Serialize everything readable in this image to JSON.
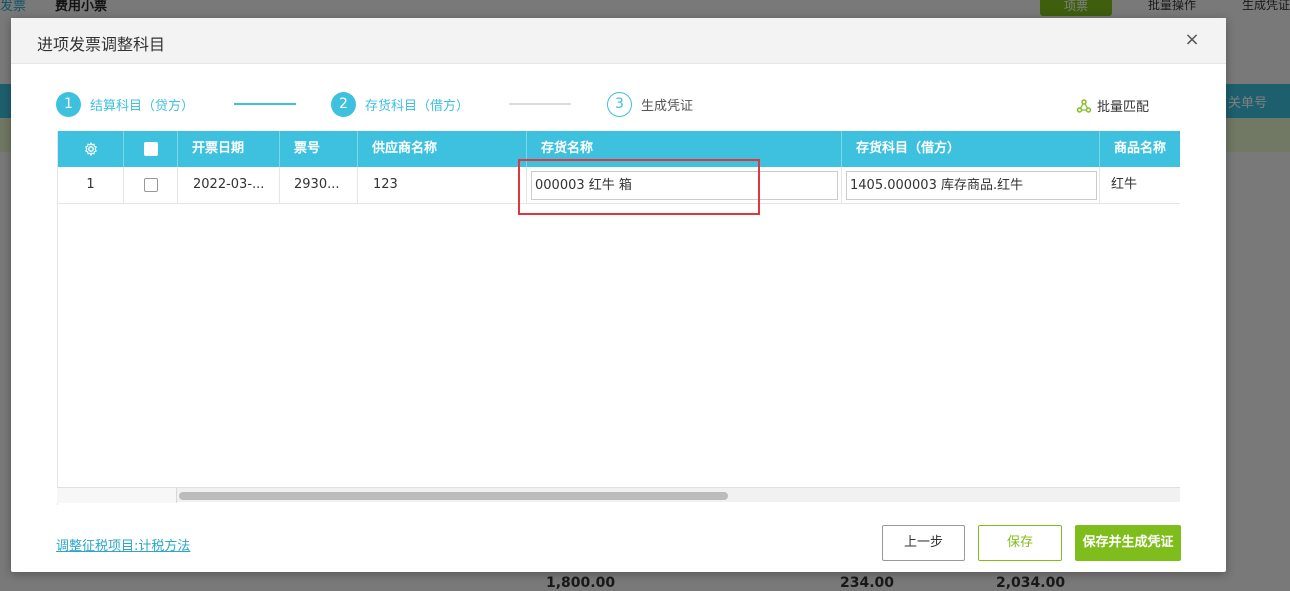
{
  "background": {
    "tab_invoice": "发票",
    "tab_expense": "费用小票",
    "top_button": "项票",
    "top_right_1": "批量操作",
    "top_right_2": "生成凭证",
    "right_header": "关单号",
    "totals": [
      "1,800.00",
      "234.00",
      "2,034.00"
    ]
  },
  "dialog": {
    "title": "进项发票调整科目",
    "close_symbol": "×"
  },
  "steps": [
    {
      "number": "1",
      "label": "结算科目（贷方）",
      "state": "active"
    },
    {
      "number": "2",
      "label": "存货科目（借方）",
      "state": "active"
    },
    {
      "number": "3",
      "label": "生成凭证",
      "state": "pending"
    }
  ],
  "batch_match": {
    "label": "批量匹配",
    "icon": "network-icon"
  },
  "table": {
    "headers": {
      "settings_icon": "gear-icon",
      "invoice_date": "开票日期",
      "invoice_no": "票号",
      "supplier": "供应商名称",
      "inventory_name": "存货名称",
      "inventory_account": "存货科目（借方）",
      "product_name": "商品名称"
    },
    "rows": [
      {
        "index": "1",
        "invoice_date": "2022-03-...",
        "invoice_no": "2930...",
        "supplier": "123",
        "inventory_name": "000003 红牛 箱",
        "inventory_account": "1405.000003 库存商品.红牛",
        "product_name": "红牛"
      }
    ]
  },
  "footer": {
    "link": "调整征税项目:计税方法",
    "prev_button": "上一步",
    "save_button": "保存",
    "save_generate_button": "保存并生成凭证"
  },
  "colors": {
    "accent": "#3ec1df",
    "green": "#7fbd1c",
    "highlight": "#e0373c"
  }
}
